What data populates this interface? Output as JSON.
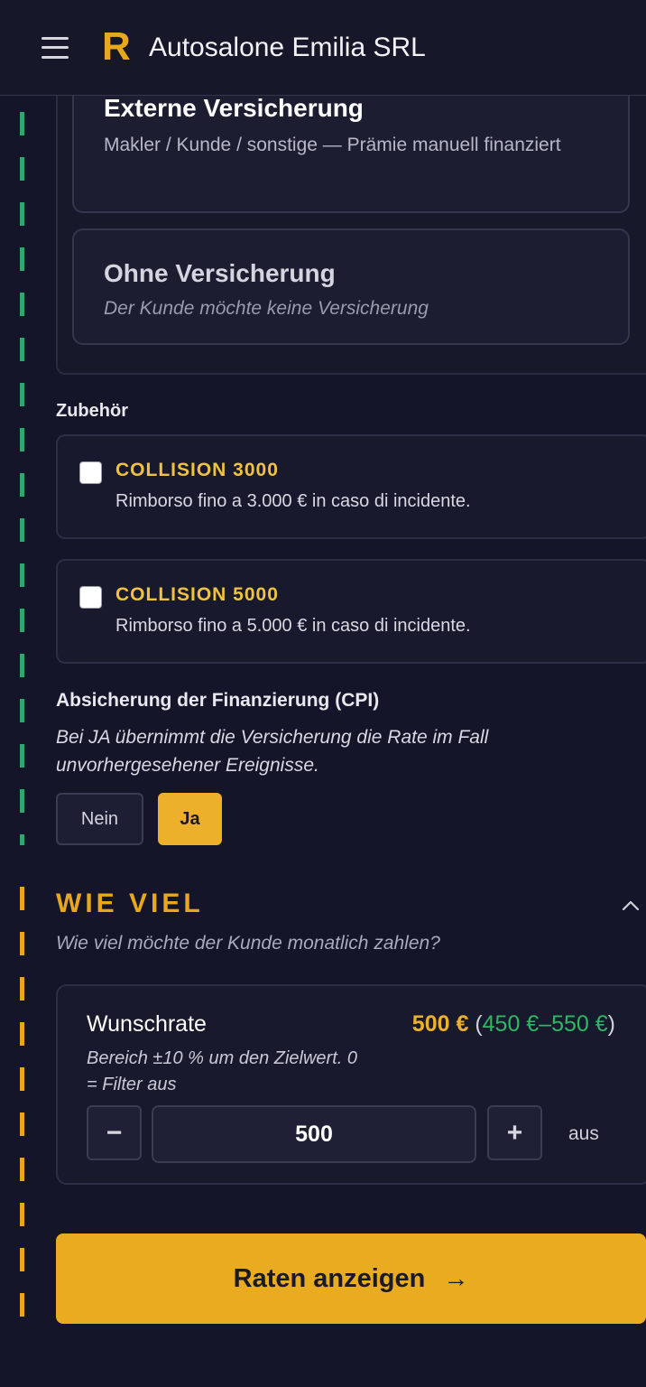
{
  "header": {
    "logo_letter": "R",
    "brand_name": "Autosalone Emilia SRL"
  },
  "insurance": {
    "options": [
      {
        "title": "Externe Versicherung",
        "description": "Makler / Kunde / sonstige — Prämie manuell finanziert"
      },
      {
        "title": "Ohne Versicherung",
        "description": "Der Kunde möchte keine Versicherung"
      }
    ]
  },
  "accessories": {
    "label": "Zubehör",
    "items": [
      {
        "title": "COLLISION 3000",
        "description": "Rimborso fino a 3.000 € in caso di incidente.",
        "checked": false
      },
      {
        "title": "COLLISION 5000",
        "description": "Rimborso fino a 5.000 € in caso di incidente.",
        "checked": false
      }
    ]
  },
  "cpi": {
    "label": "Absicherung der Finanzierung (CPI)",
    "description": "Bei JA übernimmt die Versicherung die Rate im Fall unvorhergesehener Ereignisse.",
    "no_label": "Nein",
    "yes_label": "Ja",
    "selected": "Ja"
  },
  "wie_viel": {
    "title": "WIE VIEL",
    "subtitle": "Wie viel möchte der Kunde monatlich zahlen?",
    "rate": {
      "label": "Wunschrate",
      "amount": "500 €",
      "range_open": "(",
      "range": "450 €–550 €",
      "range_close": ")",
      "help": "Bereich ±10 % um den Zielwert. 0 = Filter aus",
      "minus": "−",
      "plus": "+",
      "value": "500",
      "status": "aus"
    }
  },
  "cta": {
    "label": "Raten anzeigen",
    "arrow": "→"
  },
  "colors": {
    "accent": "#e7a81c",
    "background": "#141529",
    "green": "#2fa86a"
  }
}
